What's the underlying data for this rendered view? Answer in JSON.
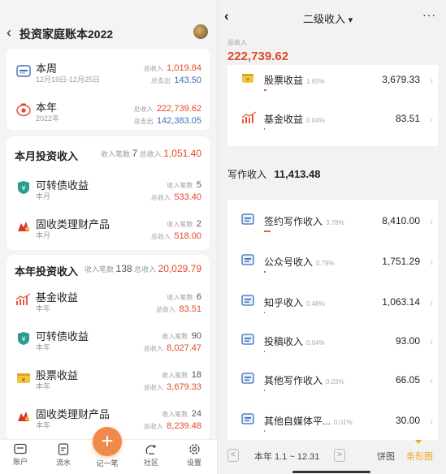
{
  "left": {
    "header": {
      "title": "投资家庭账本2022"
    },
    "summary": [
      {
        "title": "本周",
        "subtitle": "12月19日-12月25日",
        "income_label": "总收入",
        "income": "1,019.84",
        "expense_label": "总支出",
        "expense": "143.50"
      },
      {
        "title": "本年",
        "subtitle": "2022年",
        "income_label": "总收入",
        "income": "222,739.62",
        "expense_label": "总支出",
        "expense": "142,383.05"
      }
    ],
    "month_section": {
      "title": "本月投资收入",
      "count_label": "收入笔数",
      "count": "7",
      "total_label": "总收入",
      "total": "1,051.40",
      "items": [
        {
          "title": "可转债收益",
          "subtitle": "本月",
          "count_label": "收入笔数",
          "count": "5",
          "total_label": "总收入",
          "total": "533.40"
        },
        {
          "title": "固收类理财产品",
          "subtitle": "本月",
          "count_label": "收入笔数",
          "count": "2",
          "total_label": "总收入",
          "total": "518.00"
        }
      ]
    },
    "year_section": {
      "title": "本年投资收入",
      "count_label": "收入笔数",
      "count": "138",
      "total_label": "总收入",
      "total": "20,029.79",
      "items": [
        {
          "title": "基金收益",
          "subtitle": "本年",
          "count_label": "收入笔数",
          "count": "6",
          "total_label": "总收入",
          "total": "83.51"
        },
        {
          "title": "可转债收益",
          "subtitle": "本年",
          "count_label": "收入笔数",
          "count": "90",
          "total_label": "总收入",
          "total": "8,027.47"
        },
        {
          "title": "股票收益",
          "subtitle": "本年",
          "count_label": "收入笔数",
          "count": "18",
          "total_label": "总收入",
          "total": "3,679.33"
        },
        {
          "title": "固收类理财产品",
          "subtitle": "本年",
          "count_label": "收入笔数",
          "count": "24",
          "total_label": "总收入",
          "total": "8,239.48"
        }
      ]
    },
    "tabbar": {
      "account": "账户",
      "flow": "流水",
      "add": "记一笔",
      "community": "社区",
      "settings": "设置"
    }
  },
  "right": {
    "header": {
      "title": "二级收入",
      "dropdown_arrow": "▾",
      "more": "···"
    },
    "total_label": "总收入",
    "total": "222,739.62",
    "invest_rows": [
      {
        "label": "股票收益",
        "pct": "1.65%",
        "value": "3,679.33",
        "icon": "wallet-icon",
        "bar": 0.0165
      },
      {
        "label": "基金收益",
        "pct": "0.04%",
        "value": "83.51",
        "icon": "fund-chart-icon",
        "bar": 0.0004
      }
    ],
    "writing_section": {
      "title": "写作收入",
      "total": "11,413.48"
    },
    "writing_rows": [
      {
        "label": "签约写作收入",
        "pct": "3.78%",
        "value": "8,410.00",
        "bar": 0.0378
      },
      {
        "label": "公众号收入",
        "pct": "0.79%",
        "value": "1,751.29",
        "bar": 0.0079
      },
      {
        "label": "知乎收入",
        "pct": "0.48%",
        "value": "1,063.14",
        "bar": 0.0048
      },
      {
        "label": "投稿收入",
        "pct": "0.04%",
        "value": "93.00",
        "bar": 0.0004
      },
      {
        "label": "其他写作收入",
        "pct": "0.03%",
        "value": "66.05",
        "bar": 0.0003
      },
      {
        "label": "其他自媒体平...",
        "pct": "0.01%",
        "value": "30.00",
        "bar": 0.0001
      }
    ],
    "footer": {
      "period": "本年 1.1 ~ 12.31",
      "prev": "<",
      "next": ">",
      "pie": "饼图",
      "bar": "条形图"
    },
    "colors": {
      "accent": "#e85a3d",
      "active_tab": "#f0a31f"
    }
  }
}
